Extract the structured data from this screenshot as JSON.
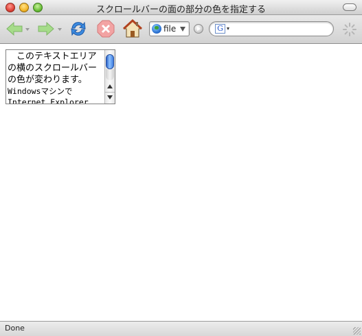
{
  "window": {
    "title": "スクロールバーの面の部分の色を指定する"
  },
  "toolbar": {
    "url_text": "file",
    "search": {
      "engine_letter": "G",
      "value": ""
    }
  },
  "textarea": {
    "lines": [
      "　このテキストエリア",
      "の横のスクロールバー",
      "の色が変わります。",
      "Windowsマシンで",
      "Internet Explorer"
    ]
  },
  "status": {
    "text": "Done"
  },
  "colors": {
    "scroll_thumb": "#3f7ee0",
    "back_forward_green": "#6cc24a",
    "stop_red": "#e88080"
  }
}
